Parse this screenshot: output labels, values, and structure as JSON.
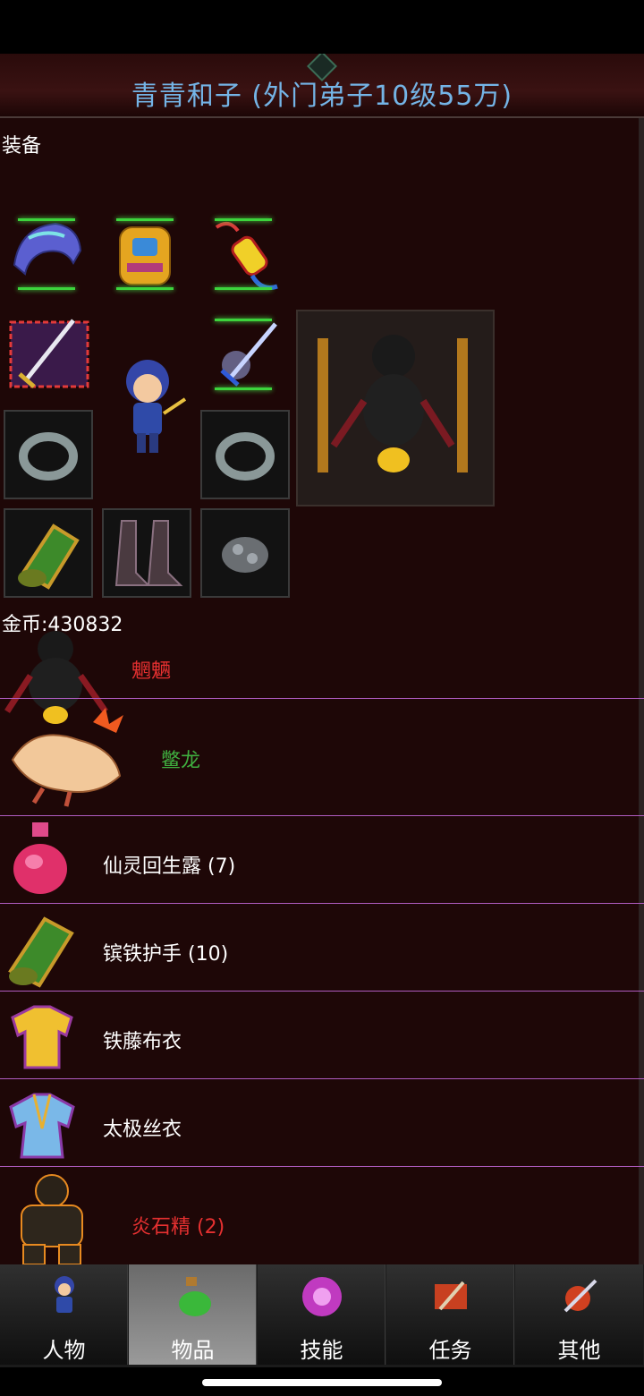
{
  "title": "青青和子 (外门弟子10级55万)",
  "equipment": {
    "label": "装备",
    "slots": [
      {
        "name": "helmet",
        "icon": "helmet-icon"
      },
      {
        "name": "armor",
        "icon": "armor-icon"
      },
      {
        "name": "accessory",
        "icon": "talisman-icon"
      },
      {
        "name": "weapon",
        "icon": "sword-icon"
      },
      {
        "name": "weapon2",
        "icon": "blue-sword-icon"
      },
      {
        "name": "ring-left",
        "icon": "ring-icon"
      },
      {
        "name": "ring-right",
        "icon": "ring-icon"
      },
      {
        "name": "bracer",
        "icon": "bracer-icon"
      },
      {
        "name": "boots",
        "icon": "boots-icon"
      },
      {
        "name": "belt",
        "icon": "belt-icon"
      }
    ]
  },
  "gold": {
    "label": "金币:430832"
  },
  "items": [
    {
      "name": "魍魉",
      "color": "#e53030",
      "icon": "shadow-demon-icon"
    },
    {
      "name": "鳖龙",
      "color": "#3fae3f",
      "icon": "fire-lizard-icon"
    },
    {
      "name": "仙灵回生露 (7)",
      "color": "#ffffff",
      "icon": "potion-icon"
    },
    {
      "name": "镔铁护手 (10)",
      "color": "#ffffff",
      "icon": "bracer-icon"
    },
    {
      "name": "铁藤布衣",
      "color": "#ffffff",
      "icon": "robe-icon"
    },
    {
      "name": "太极丝衣",
      "color": "#ffffff",
      "icon": "silk-robe-icon"
    },
    {
      "name": "炎石精 (2)",
      "color": "#e53030",
      "icon": "stone-golem-icon"
    }
  ],
  "tabs": [
    {
      "label": "人物",
      "icon": "character-icon",
      "active": false
    },
    {
      "label": "物品",
      "icon": "potion-bag-icon",
      "active": true
    },
    {
      "label": "技能",
      "icon": "skill-orb-icon",
      "active": false
    },
    {
      "label": "任务",
      "icon": "quest-scroll-icon",
      "active": false
    },
    {
      "label": "其他",
      "icon": "other-sword-icon",
      "active": false
    }
  ]
}
